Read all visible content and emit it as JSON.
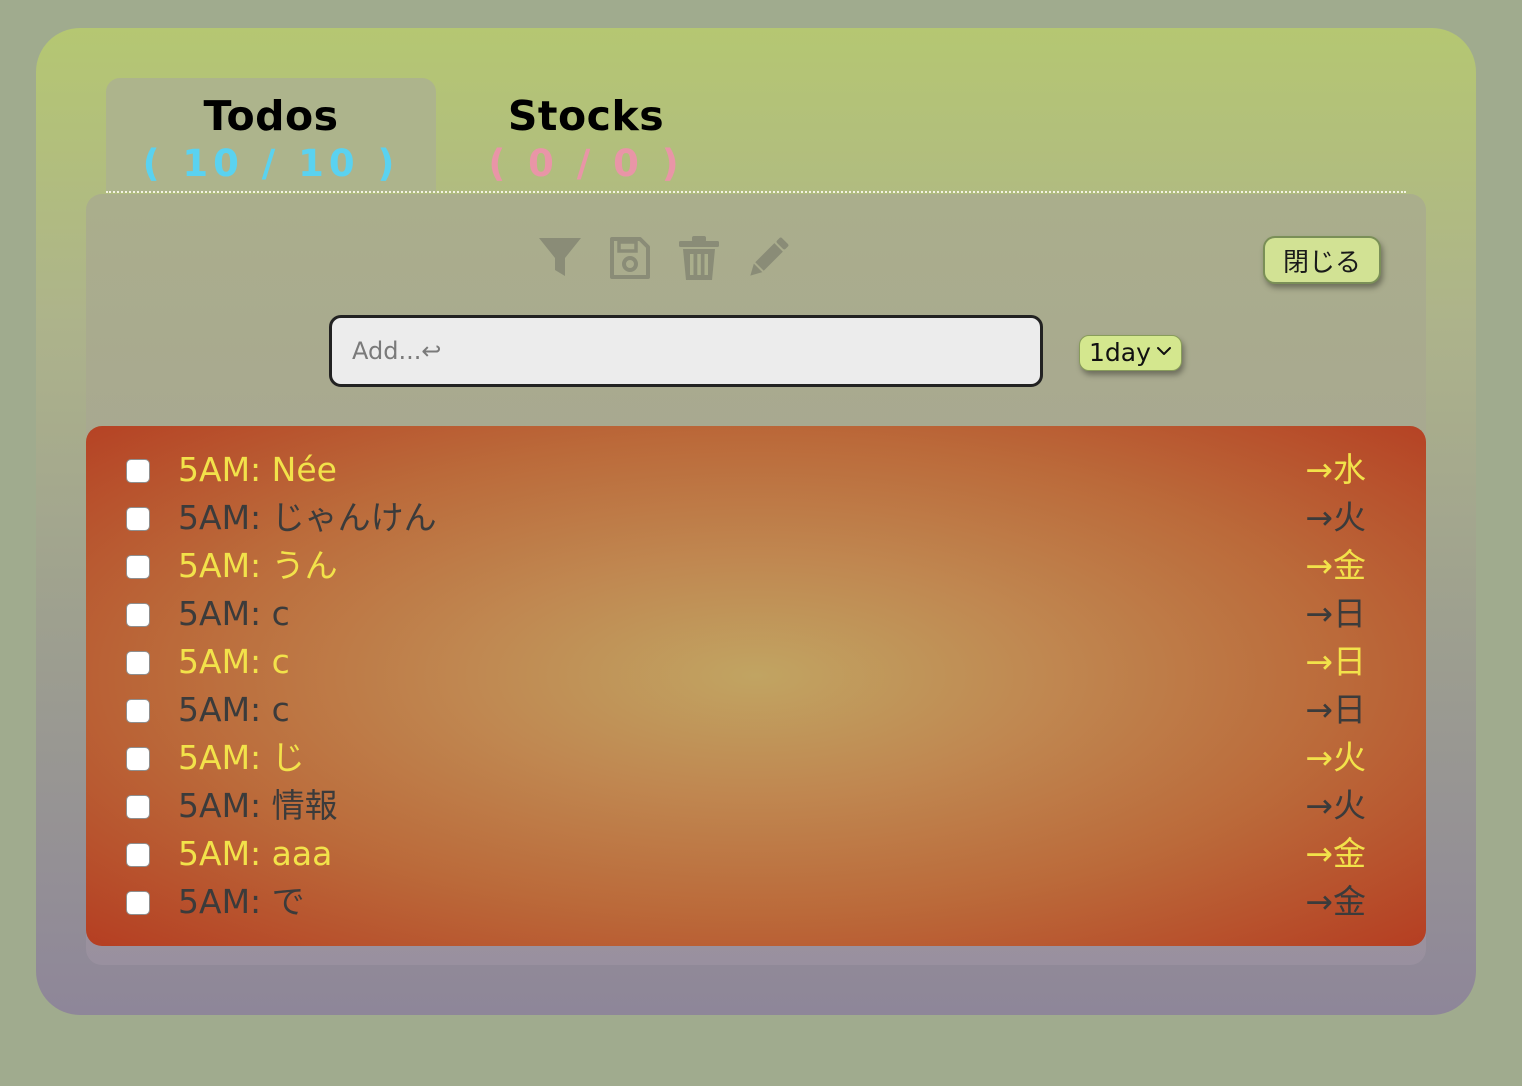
{
  "tabs": [
    {
      "title": "Todos",
      "count": "( 10 / 10 )",
      "count_color": "#5ad2f0"
    },
    {
      "title": "Stocks",
      "count": "( 0 / 0 )",
      "count_color": "#e995a7"
    }
  ],
  "toolbar": {
    "icons": [
      "filter-icon",
      "save-icon",
      "trash-icon",
      "pencil-icon"
    ],
    "close_label": "閉じる"
  },
  "add_input": {
    "placeholder": "Add...↩",
    "value": ""
  },
  "repeat_select": {
    "value": "1day"
  },
  "colors": {
    "highlight_text": "#f2e24a",
    "normal_text": "#3b3b3b",
    "accent_green": "#d4e78e"
  },
  "todos": [
    {
      "text": "5AM: Née",
      "day": "→水",
      "highlight": true
    },
    {
      "text": "5AM: じゃんけん",
      "day": "→火",
      "highlight": false
    },
    {
      "text": "5AM: うん",
      "day": "→金",
      "highlight": true
    },
    {
      "text": "5AM: c",
      "day": "→日",
      "highlight": false
    },
    {
      "text": "5AM: c",
      "day": "→日",
      "highlight": true
    },
    {
      "text": "5AM: c",
      "day": "→日",
      "highlight": false
    },
    {
      "text": "5AM: じ",
      "day": "→火",
      "highlight": true
    },
    {
      "text": "5AM: 情報",
      "day": "→火",
      "highlight": false
    },
    {
      "text": "5AM: aaa",
      "day": "→金",
      "highlight": true
    },
    {
      "text": "5AM: で",
      "day": "→金",
      "highlight": false
    }
  ]
}
